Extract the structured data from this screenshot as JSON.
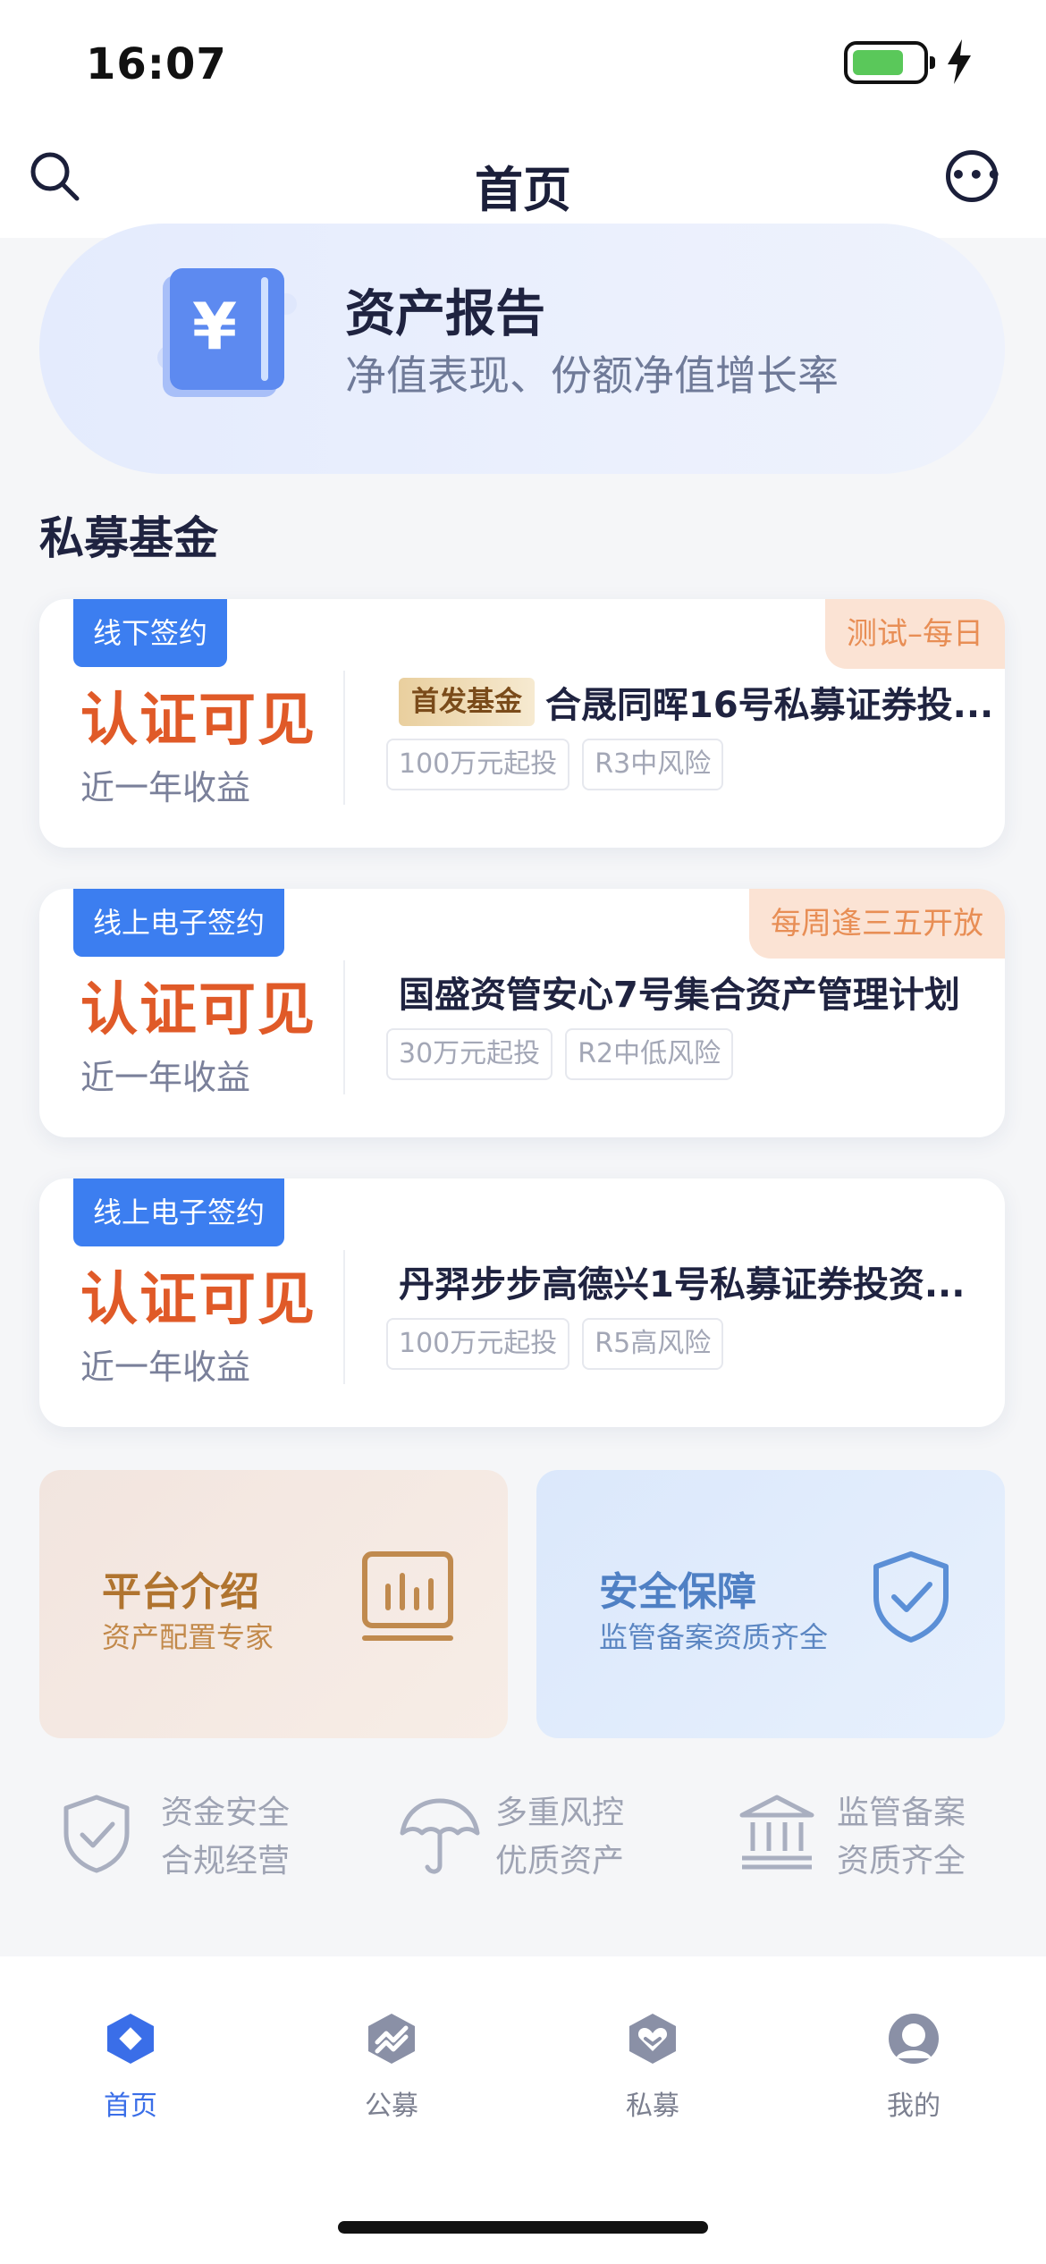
{
  "status_bar": {
    "time": "16:07"
  },
  "header": {
    "title": "首页"
  },
  "banner": {
    "title": "资产报告",
    "subtitle": "净值表现、份额净值增长率",
    "icon_symbol": "¥"
  },
  "section": {
    "title": "私募基金"
  },
  "funds": [
    {
      "sign_type": "线下签约",
      "corner_tag": "测试–每日",
      "yield_value": "认证可见",
      "yield_label": "近一年收益",
      "badge": "首发基金",
      "name": "合晟同晖16号私募证券投...",
      "chips": [
        "100万元起投",
        "R3中风险"
      ]
    },
    {
      "sign_type": "线上电子签约",
      "corner_tag": "每周逢三五开放",
      "yield_value": "认证可见",
      "yield_label": "近一年收益",
      "badge": "",
      "name": "国盛资管安心7号集合资产管理计划",
      "chips": [
        "30万元起投",
        "R2中低风险"
      ]
    },
    {
      "sign_type": "线上电子签约",
      "corner_tag": "",
      "yield_value": "认证可见",
      "yield_label": "近一年收益",
      "badge": "",
      "name": "丹羿步步高德兴1号私募证券投资...",
      "chips": [
        "100万元起投",
        "R5高风险"
      ]
    }
  ],
  "tiles": {
    "platform": {
      "title": "平台介绍",
      "subtitle": "资产配置专家"
    },
    "security": {
      "title": "安全保障",
      "subtitle": "监管备案资质齐全"
    }
  },
  "trust": [
    {
      "line1": "资金安全",
      "line2": "合规经营",
      "icon": "shield-check-icon"
    },
    {
      "line1": "多重风控",
      "line2": "优质资产",
      "icon": "umbrella-icon"
    },
    {
      "line1": "监管备案",
      "line2": "资质齐全",
      "icon": "bank-building-icon"
    }
  ],
  "tabbar": {
    "items": [
      {
        "label": "首页",
        "icon": "home-diamond-icon",
        "active": true
      },
      {
        "label": "公募",
        "icon": "public-fund-icon",
        "active": false
      },
      {
        "label": "私募",
        "icon": "private-fund-icon",
        "active": false
      },
      {
        "label": "我的",
        "icon": "profile-icon",
        "active": false
      }
    ]
  },
  "colors": {
    "accent": "#3c7ef0",
    "yield": "#e05a28",
    "tab_active": "#3a6ee8",
    "tab_inactive": "#8a90a6"
  }
}
